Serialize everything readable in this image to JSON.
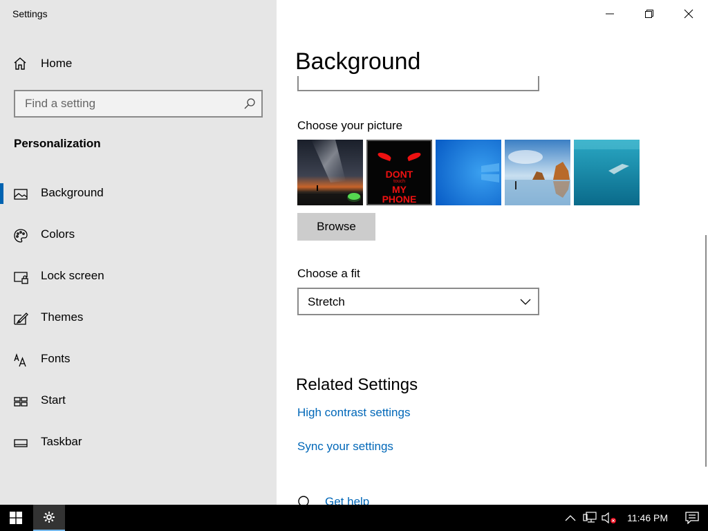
{
  "app": {
    "title": "Settings"
  },
  "sidebar": {
    "home_label": "Home",
    "search_placeholder": "Find a setting",
    "section_title": "Personalization",
    "items": [
      {
        "label": "Background",
        "icon": "picture-icon",
        "active": true
      },
      {
        "label": "Colors",
        "icon": "palette-icon",
        "active": false
      },
      {
        "label": "Lock screen",
        "icon": "lock-screen-icon",
        "active": false
      },
      {
        "label": "Themes",
        "icon": "themes-brush-icon",
        "active": false
      },
      {
        "label": "Fonts",
        "icon": "fonts-icon",
        "active": false
      },
      {
        "label": "Start",
        "icon": "start-tiles-icon",
        "active": false
      },
      {
        "label": "Taskbar",
        "icon": "taskbar-icon",
        "active": false
      }
    ]
  },
  "main": {
    "title": "Background",
    "choose_picture_label": "Choose your picture",
    "pictures": [
      {
        "name": "milky-way-camping"
      },
      {
        "name": "dont-touch-my-phone",
        "text_top": "DONT",
        "text_mid": "touch",
        "text_bot": "MY",
        "text_last": "PHONE"
      },
      {
        "name": "windows-blue"
      },
      {
        "name": "beach-rocks"
      },
      {
        "name": "underwater-swimmer"
      }
    ],
    "browse_label": "Browse",
    "fit_label": "Choose a fit",
    "fit_value": "Stretch",
    "related_title": "Related Settings",
    "links": [
      "High contrast settings",
      "Sync your settings"
    ],
    "get_help": "Get help"
  },
  "taskbar": {
    "clock": "11:46 PM"
  },
  "colors": {
    "accent": "#0063b1",
    "link": "#0067b8",
    "sidebar_bg": "#e6e6e6",
    "taskbar_bg": "#000000"
  }
}
